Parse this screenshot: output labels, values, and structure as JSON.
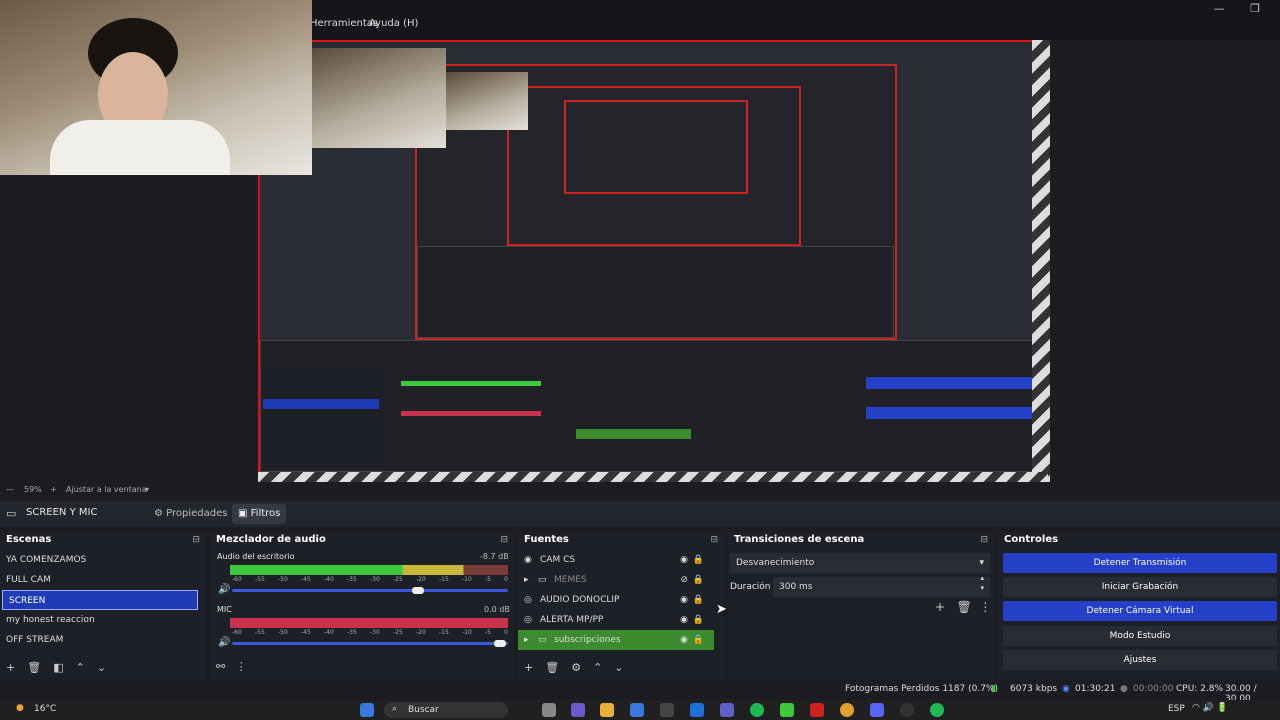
{
  "menubar": {
    "items": [
      "Herramientas",
      "Ayuda (H)"
    ]
  },
  "zoombar": {
    "zoom": "59%",
    "fit": "Ajustar a la ventana"
  },
  "scenebar": {
    "scene_name": "SCREEN Y MIC",
    "properties": "Propiedades",
    "filters": "Filtros"
  },
  "scenes": {
    "title": "Escenas",
    "items": [
      {
        "label": "YA COMENZAMOS"
      },
      {
        "label": "FULL CAM"
      },
      {
        "label": "SCREEN"
      },
      {
        "label": "my honest reaccion"
      },
      {
        "label": "OFF STREAM"
      }
    ],
    "selected": "SCREEN"
  },
  "mixer": {
    "title": "Mezclador de audio",
    "channels": [
      {
        "name": "Audio del escritorio",
        "db": "-8.7 dB",
        "level": 0.84
      },
      {
        "name": "MIC",
        "db": "0.0 dB",
        "level": 1.0
      }
    ],
    "ticks": [
      "-60",
      "-55",
      "-50",
      "-45",
      "-40",
      "-35",
      "-30",
      "-25",
      "-20",
      "-15",
      "-10",
      "-5",
      "0"
    ]
  },
  "sources": {
    "title": "Fuentes",
    "items": [
      {
        "label": "CAM CS"
      },
      {
        "label": "MEMES"
      },
      {
        "label": "AUDIO DONOCLIP"
      },
      {
        "label": "ALERTA MP/PP"
      },
      {
        "label": "subscripciones"
      }
    ]
  },
  "transitions": {
    "title": "Transiciones de escena",
    "type": "Desvanecimiento",
    "duration_label": "Duración",
    "duration_value": "300 ms"
  },
  "controls": {
    "title": "Controles",
    "buttons": [
      {
        "label": "Detener Transmisión",
        "active": true
      },
      {
        "label": "Iniciar Grabación",
        "active": false
      },
      {
        "label": "Detener Cámara Virtual",
        "active": true
      },
      {
        "label": "Modo Estudio",
        "active": false
      },
      {
        "label": "Ajustes",
        "active": false
      }
    ]
  },
  "status": {
    "dropped": "Fotogramas Perdidos 1187 (0.7%)",
    "bitrate": "6073 kbps",
    "stream_time": "01:30:21",
    "rec_time": "00:00:00",
    "cpu": "CPU: 2.8%",
    "fps": "30.00 / 30.00"
  },
  "taskbar": {
    "weather": "16°C",
    "search": "Buscar",
    "lang": "ESP"
  },
  "colors": {
    "accent": "#2340c7",
    "selected_source": "#3d8b2f",
    "border_red": "#d11111"
  }
}
